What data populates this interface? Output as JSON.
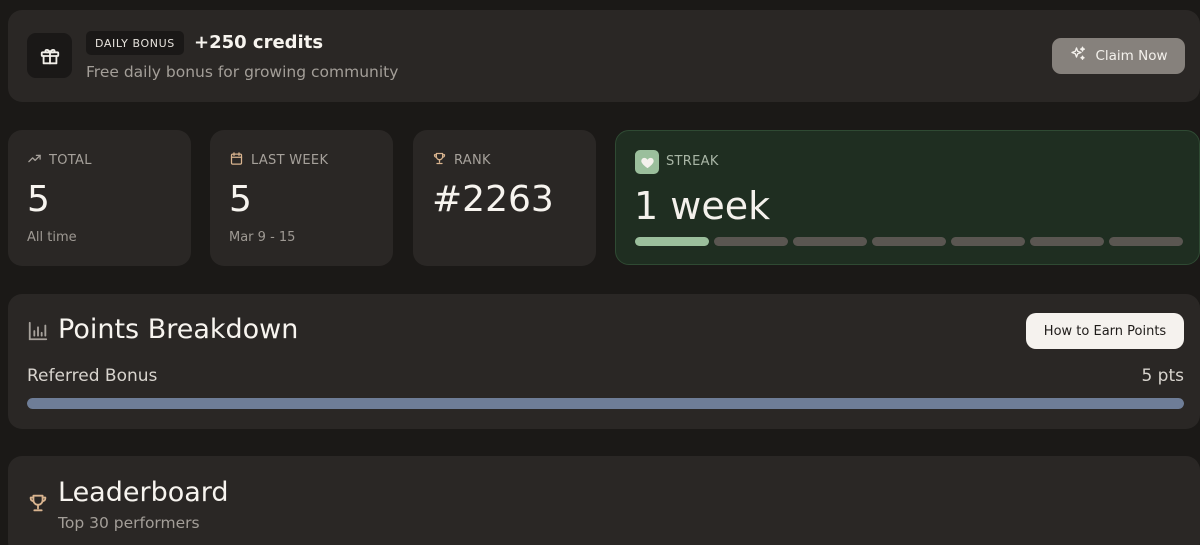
{
  "bonus": {
    "icon": "gift-icon",
    "badge": "DAILY BONUS",
    "amount": "+250 credits",
    "description": "Free daily bonus for growing community",
    "claim_label": "Claim Now",
    "claim_icon": "sparkles-icon"
  },
  "stats": {
    "total": {
      "icon": "trending-up-icon",
      "label": "TOTAL",
      "value": "5",
      "sub": "All time"
    },
    "last_week": {
      "icon": "calendar-icon",
      "label": "LAST WEEK",
      "value": "5",
      "sub": "Mar 9 - 15"
    },
    "rank": {
      "icon": "trophy-icon",
      "label": "RANK",
      "value": "#2263"
    },
    "streak": {
      "icon": "heart-icon",
      "label": "STREAK",
      "value": "1 week",
      "segments_total": 7,
      "segments_filled": 1,
      "accent": "#9bbf9c"
    }
  },
  "breakdown": {
    "icon": "bar-chart-icon",
    "title": "Points Breakdown",
    "earn_label": "How to Earn Points",
    "rows": [
      {
        "label": "Referred Bonus",
        "value": "5 pts",
        "fill_fraction": 1.0
      }
    ]
  },
  "leaderboard": {
    "icon": "trophy-icon",
    "title": "Leaderboard",
    "subtitle": "Top 30 performers"
  },
  "colors": {
    "background": "#1b1917",
    "card": "#2a2725",
    "streak_card": "#1f2e21",
    "progress": "#6e7d97",
    "trophy": "#d9b48f"
  }
}
